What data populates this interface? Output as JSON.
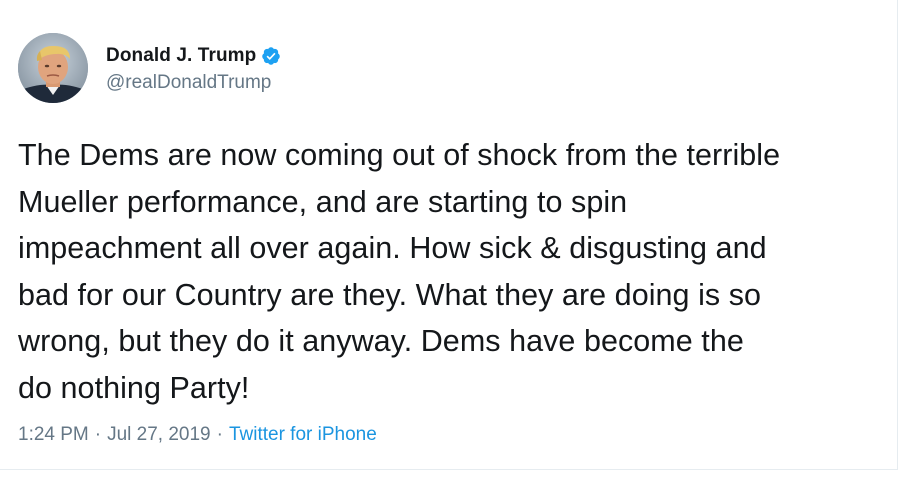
{
  "author": {
    "display_name": "Donald J. Trump",
    "handle": "@realDonaldTrump",
    "verified": true,
    "avatar_icon": "profile-photo",
    "verified_icon": "verified-badge-icon",
    "verified_color": "#1da1f2"
  },
  "tweet": {
    "text": "The Dems are now coming out of shock from the terrible\nMueller performance, and are starting to spin\nimpeachment all over again. How sick & disgusting and\nbad for our Country are they. What they are doing is so\nwrong, but they do it anyway. Dems have become the\ndo nothing Party!",
    "time": "1:24 PM",
    "separator": "·",
    "date": "Jul 27, 2019",
    "source": "Twitter for iPhone"
  },
  "colors": {
    "text": "#14171a",
    "secondary": "#657786",
    "link": "#1b95e0"
  }
}
